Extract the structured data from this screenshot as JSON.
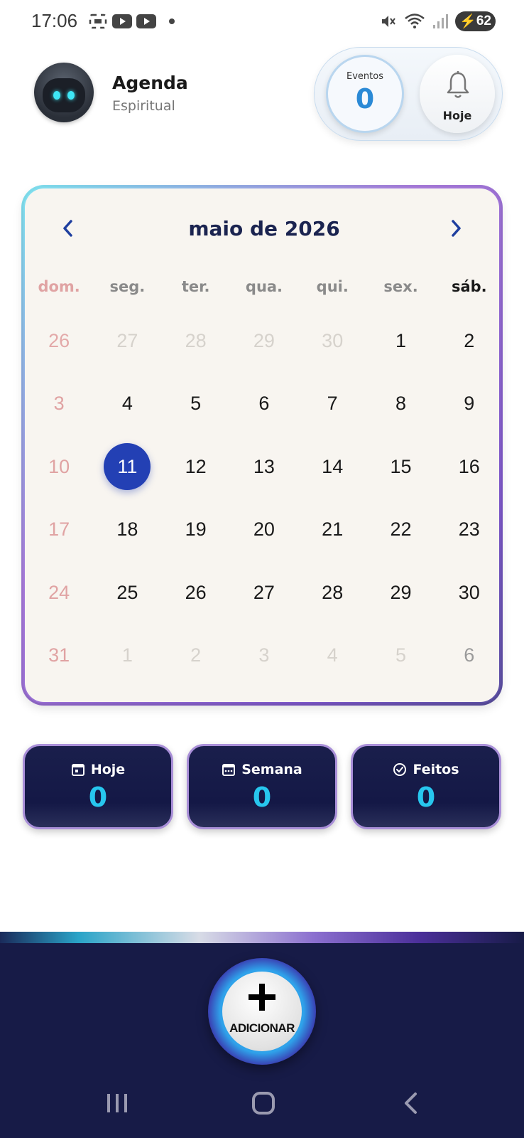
{
  "status_bar": {
    "time": "17:06",
    "battery": "62"
  },
  "header": {
    "title": "Agenda",
    "subtitle": "Espiritual",
    "events_label": "Eventos",
    "events_count": "0",
    "today_label": "Hoje"
  },
  "calendar": {
    "month_title": "maio de 2026",
    "weekdays": [
      "dom.",
      "seg.",
      "ter.",
      "qua.",
      "qui.",
      "sex.",
      "sáb."
    ],
    "days": [
      "26",
      "27",
      "28",
      "29",
      "30",
      "1",
      "2",
      "3",
      "4",
      "5",
      "6",
      "7",
      "8",
      "9",
      "10",
      "11",
      "12",
      "13",
      "14",
      "15",
      "16",
      "17",
      "18",
      "19",
      "20",
      "21",
      "22",
      "23",
      "24",
      "25",
      "26",
      "27",
      "28",
      "29",
      "30",
      "31",
      "1",
      "2",
      "3",
      "4",
      "5",
      "6"
    ],
    "selected_day": "11"
  },
  "stats": [
    {
      "label": "Hoje",
      "value": "0",
      "icon": "calendar-day-icon"
    },
    {
      "label": "Semana",
      "value": "0",
      "icon": "calendar-week-icon"
    },
    {
      "label": "Feitos",
      "value": "0",
      "icon": "check-circle-icon"
    }
  ],
  "add_button": {
    "label": "ADICIONAR"
  },
  "colors": {
    "accent": "#2340b4",
    "stat_value": "#27c6ee",
    "bottom_bar": "#171b47"
  }
}
